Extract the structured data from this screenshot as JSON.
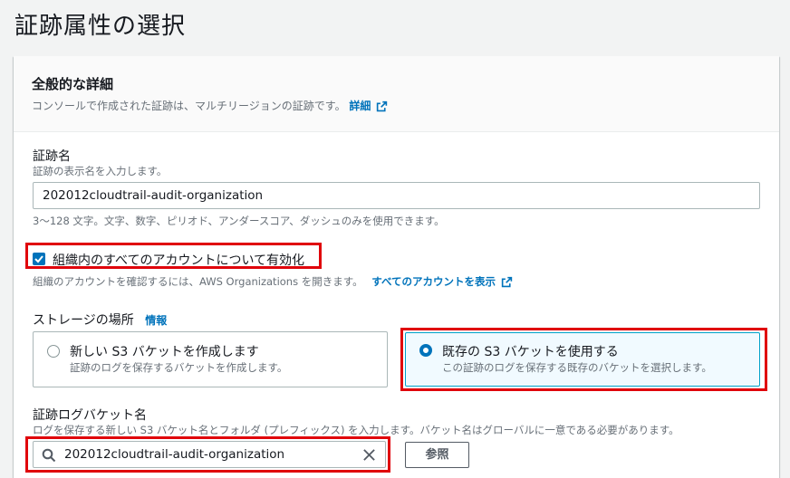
{
  "page": {
    "title": "証跡属性の選択"
  },
  "general": {
    "title": "全般的な詳細",
    "description": "コンソールで作成された証跡は、マルチリージョンの証跡です。",
    "details_link": "詳細"
  },
  "trail_name": {
    "label": "証跡名",
    "description": "証跡の表示名を入力します。",
    "value": "202012cloudtrail-audit-organization",
    "constraint": "3～128 文字。文字、数字、ピリオド、アンダースコア、ダッシュのみを使用できます。"
  },
  "organization": {
    "checkbox_label": "組織内のすべてのアカウントについて有効化",
    "checked": true,
    "description": "組織のアカウントを確認するには、AWS Organizations を開きます。",
    "view_accounts_link": "すべてのアカウントを表示"
  },
  "storage": {
    "label": "ストレージの場所",
    "info_link": "情報",
    "options": [
      {
        "title": "新しい S3 バケットを作成します",
        "description": "証跡のログを保存するバケットを作成します。",
        "selected": false
      },
      {
        "title": "既存の S3 バケットを使用する",
        "description": "この証跡のログを保存する既存のバケットを選択します。",
        "selected": true
      }
    ]
  },
  "bucket": {
    "label": "証跡ログバケット名",
    "description": "ログを保存する新しい S3 バケット名とフォルダ (プレフィックス) を入力します。バケット名はグローバルに一意である必要があります。",
    "value": "202012cloudtrail-audit-organization",
    "browse_label": "参照"
  },
  "colors": {
    "link": "#0073bb",
    "highlight": "#e0040b",
    "selected_border": "#00a1c9"
  }
}
